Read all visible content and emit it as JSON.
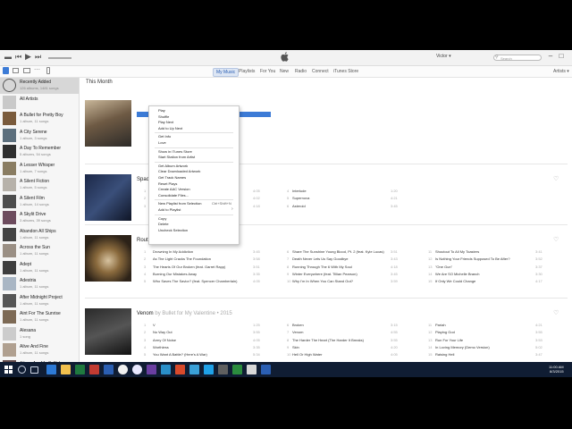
{
  "toolbar": {
    "account": "Victor ▾",
    "search_placeholder": "Search"
  },
  "nav": {
    "tabs": [
      "My Music",
      "Playlists",
      "For You",
      "New",
      "Radio",
      "Connect",
      "iTunes Store"
    ],
    "active": "My Music",
    "view_selector": "Artists ▾"
  },
  "sidebar": {
    "items": [
      {
        "name": "Recently Added",
        "sub": "126 albums, 1481 songs"
      },
      {
        "name": "All Artists",
        "sub": ""
      },
      {
        "name": "A Bullet for Pretty Boy",
        "sub": "1 album, 11 songs"
      },
      {
        "name": "A City Serene",
        "sub": "1 album, 3 songs"
      },
      {
        "name": "A Day To Remember",
        "sub": "5 albums, 54 songs"
      },
      {
        "name": "A Lesser Whisper",
        "sub": "1 album, 7 songs"
      },
      {
        "name": "A Silent Fiction",
        "sub": "1 album, 5 songs"
      },
      {
        "name": "A Silent Film",
        "sub": "1 album, 14 songs"
      },
      {
        "name": "A Skylit Drive",
        "sub": "3 albums, 39 songs"
      },
      {
        "name": "Abandon All Ships",
        "sub": "1 album, 11 songs"
      },
      {
        "name": "Across the Sun",
        "sub": "1 album, 11 songs"
      },
      {
        "name": "Adept",
        "sub": "1 album, 11 songs"
      },
      {
        "name": "Adestria",
        "sub": "1 album, 11 songs"
      },
      {
        "name": "After Midnight Project",
        "sub": "1 album, 11 songs"
      },
      {
        "name": "Aint For The Sunrise",
        "sub": "1 album, 11 songs"
      },
      {
        "name": "Alesana",
        "sub": "1 song"
      },
      {
        "name": "Alive And Fine",
        "sub": "1 album, 11 songs"
      },
      {
        "name": "Aliens Are My Selfish",
        "sub": "1 album, 10 songs"
      }
    ]
  },
  "main": {
    "section_title": "This Month",
    "albums": [
      {
        "title": "Spac",
        "sub": "",
        "col1": [
          "",
          "",
          ""
        ],
        "col1_nums": [
          "1",
          "2",
          "3"
        ],
        "col1_durs": [
          "4:05",
          "4:02",
          "4:18"
        ],
        "col2": [
          "Interlude",
          "Supernova",
          "Asteroid"
        ],
        "col2_nums": [
          "4",
          "5",
          "6"
        ],
        "col2_durs": [
          "1:20",
          "4:21",
          "3:45"
        ]
      },
      {
        "title": "Rout",
        "sub": "",
        "col1": [
          "Drowning In My Addiction",
          "As The Light Cracks The Foundation",
          "The Hearts Of Our Broken (feat. Garret Rapp)",
          "Burning Our Mistakes Away",
          "Who Saves The Savior? (feat. Spencer Chamberlain)"
        ],
        "col1_nums": [
          "1",
          "2",
          "3",
          "4",
          "5"
        ],
        "col1_durs": [
          "3:45",
          "3:58",
          "3:51",
          "3:35",
          "4:05"
        ],
        "col2": [
          "Share The Sunshine Young Blood, Pt. 2 (feat. Kyle Lucas)",
          "Death Never Lets Us Say Goodbye",
          "Running Through The 6 With My Soul",
          "Winter Everywhere (feat. Tillian Pearson)",
          "Why I'm In When You Can Stand Out?"
        ],
        "col2_nums": [
          "6",
          "7",
          "8",
          "9",
          "10"
        ],
        "col2_durs": [
          "3:51",
          "3:43",
          "4:18",
          "3:45",
          "3:59"
        ],
        "col3": [
          "Shoutout To All My Toasters",
          "Is Nothing Your Friends Supposed To Be After?",
          "\"One Gun\"",
          "We Are SO Michelle Branch",
          "If Only We Could Change"
        ],
        "col3_nums": [
          "11",
          "12",
          "13",
          "14",
          "15"
        ],
        "col3_durs": [
          "3:41",
          "3:52",
          "3:37",
          "3:30",
          "4:17"
        ]
      },
      {
        "title": "Venom",
        "sub": "by Bullet for My Valentine • 2015",
        "col1": [
          "V",
          "No Way Out",
          "Army Of Noise",
          "Worthless",
          "You Want A Battle? (Here's A War)"
        ],
        "col1_nums": [
          "1",
          "2",
          "3",
          "4",
          "5"
        ],
        "col1_durs": [
          "1:25",
          "3:55",
          "4:05",
          "3:35",
          "5:34"
        ],
        "col2": [
          "Broken",
          "Venom",
          "The Harder The Heart (The Harder It Breaks)",
          "Skin",
          "Hell Or High Water"
        ],
        "col2_nums": [
          "6",
          "7",
          "8",
          "9",
          "10"
        ],
        "col2_durs": [
          "3:15",
          "4:55",
          "3:55",
          "4:20",
          "4:05"
        ],
        "col3": [
          "Pariah",
          "Playing God",
          "Run For Your Life",
          "In Loving Memory (Demo Version)",
          "Raising Hell"
        ],
        "col3_nums": [
          "11",
          "12",
          "13",
          "14",
          "15"
        ],
        "col3_durs": [
          "4:21",
          "3:55",
          "3:53",
          "5:02",
          "3:47"
        ]
      }
    ]
  },
  "context_menu": {
    "items": [
      "Play",
      "Shuffle",
      "Play Next",
      "Add to Up Next",
      "Get Info",
      "Love",
      "Show in iTunes Store",
      "Start Station from Artist",
      "Get Album Artwork",
      "Clear Downloaded Artwork",
      "Get Track Names",
      "Reset Plays",
      "Create AAC Version",
      "Consolidate Files...",
      "New Playlist from Selection",
      "Add to Playlist",
      "Copy",
      "Delete",
      "Uncheck Selection"
    ],
    "shortcut": "Ctrl+Shift+N"
  },
  "taskbar": {
    "time": "11:00 AM",
    "date": "8/3/2015"
  },
  "colors": {
    "accent": "#3c7bd6",
    "taskbar": "#101d33",
    "sidebar_selected": "#d7d7d7"
  }
}
